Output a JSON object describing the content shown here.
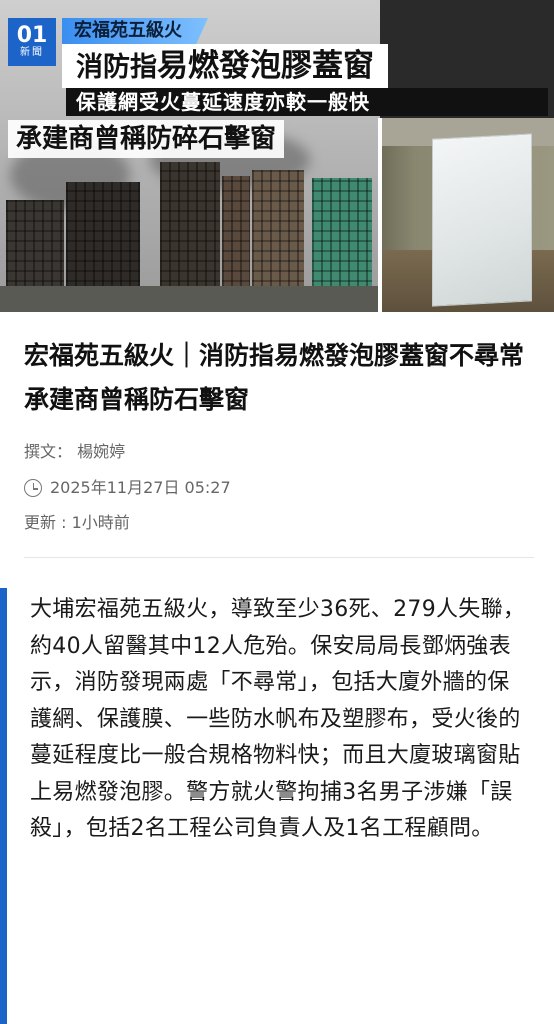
{
  "hero": {
    "logo_main": "01",
    "logo_sub": "新聞",
    "tag": "宏福苑五級火",
    "headline_lead": "消防指",
    "headline_main": "易燃發泡膠蓋窗",
    "subline": "保護網受火蔓延速度亦較一般快",
    "caption": "承建商曾稱防碎石擊窗"
  },
  "article": {
    "title": "宏福苑五級火｜消防指易燃發泡膠蓋窗不尋常　承建商曾稱防石擊窗",
    "author": "撰文：  楊婉婷",
    "published": "2025年11月27日 05:27",
    "updated": "更新 : 1小時前",
    "lead": "大埔宏福苑五級火，導致至少36死、279人失聯，約40人留醫其中12人危殆。保安局局長鄧炳強表示，消防發現兩處「不尋常」，包括大廈外牆的保護網、保護膜、一些防水帆布及塑膠布，受火後的蔓延程度比一般合規格物料快；而且大廈玻璃窗貼上易燃發泡膠。警方就火警拘捕3名男子涉嫌「誤殺」，包括2名工程公司負責人及1名工程顧問。"
  },
  "colors": {
    "brand_blue": "#1c64c8",
    "meta_gray": "#666666"
  },
  "icons": {
    "published_icon": "clock-icon"
  }
}
